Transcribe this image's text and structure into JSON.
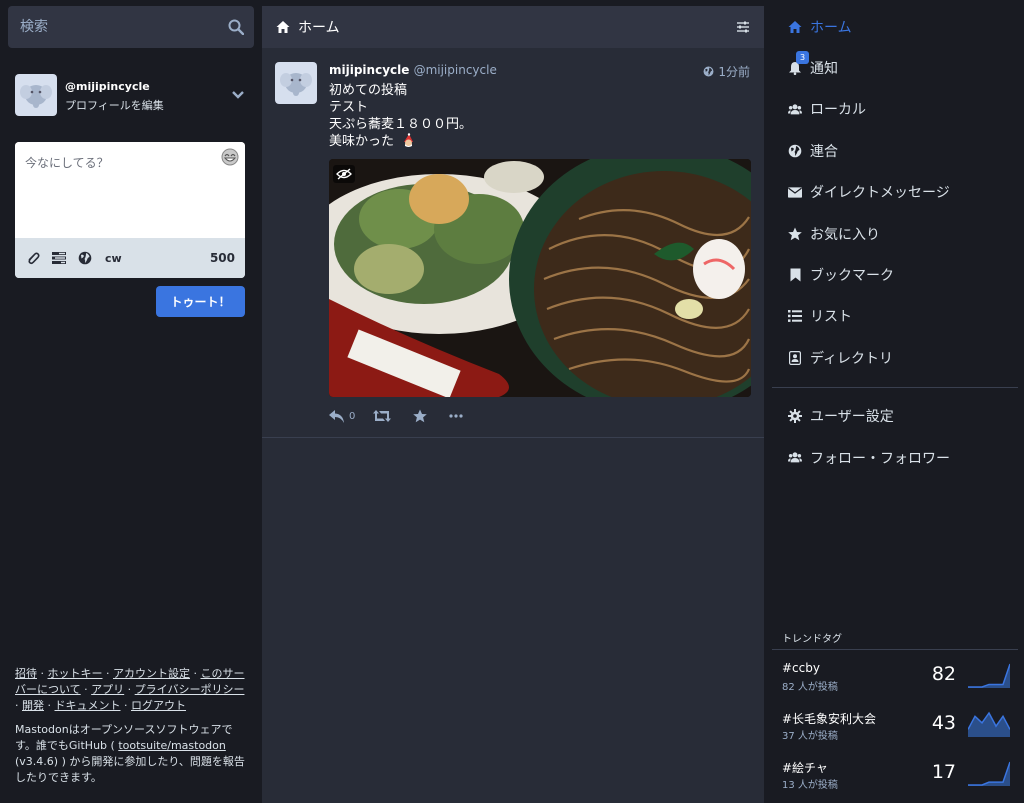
{
  "search": {
    "placeholder": "検索"
  },
  "account": {
    "handle": "@mijipincycle",
    "edit_label": "プロフィールを編集"
  },
  "compose": {
    "placeholder": "今なにしてる？",
    "cw_label": "cw",
    "char_count": "500",
    "submit_label": "トゥート！"
  },
  "footer": {
    "links": [
      {
        "label": "招待"
      },
      {
        "label": "ホットキー"
      },
      {
        "label": "アカウント設定"
      },
      {
        "label": "このサーバーについて"
      },
      {
        "label": "アプリ"
      },
      {
        "label": "プライバシーポリシー"
      },
      {
        "label": "開発"
      },
      {
        "label": "ドキュメント"
      },
      {
        "label": "ログアウト"
      }
    ],
    "separator": " · ",
    "about_prefix": "Mastodonはオープンソースソフトウェアです。誰でもGitHub ( ",
    "about_link": "tootsuite/mastodon",
    "about_suffix": " (v3.4.6) ) から開発に参加したり、問題を報告したりできます。"
  },
  "column": {
    "title": "ホーム"
  },
  "status": {
    "display_name": "mijipincycle",
    "acct": "@mijipincycle",
    "time": "1分前",
    "lines": [
      "初めての投稿",
      "テスト",
      "天ぷら蕎麦１８００円。",
      "美味かった"
    ],
    "reply_count": "0"
  },
  "nav": {
    "items": [
      {
        "label": "ホーム",
        "icon": "home-icon",
        "active": true
      },
      {
        "label": "通知",
        "icon": "bell-icon",
        "badge": "3"
      },
      {
        "label": "ローカル",
        "icon": "users-icon"
      },
      {
        "label": "連合",
        "icon": "globe-icon"
      },
      {
        "label": "ダイレクトメッセージ",
        "icon": "envelope-icon"
      },
      {
        "label": "お気に入り",
        "icon": "star-icon"
      },
      {
        "label": "ブックマーク",
        "icon": "bookmark-icon"
      },
      {
        "label": "リスト",
        "icon": "list-icon"
      },
      {
        "label": "ディレクトリ",
        "icon": "address-book-icon"
      }
    ],
    "secondary": [
      {
        "label": "ユーザー設定",
        "icon": "gear-icon"
      },
      {
        "label": "フォロー・フォロワー",
        "icon": "users-icon"
      }
    ]
  },
  "trends": {
    "title": "トレンドタグ",
    "items": [
      {
        "tag": "#ccby",
        "count_label": "82 人が投稿",
        "uses": "82",
        "history": [
          0,
          0,
          0,
          1,
          1,
          1,
          9
        ]
      },
      {
        "tag": "#长毛象安利大会",
        "count_label": "37 人が投稿",
        "uses": "43",
        "history": [
          2,
          6,
          4,
          7,
          3,
          6,
          2
        ]
      },
      {
        "tag": "#絵チャ",
        "count_label": "13 人が投稿",
        "uses": "17",
        "history": [
          0,
          0,
          0,
          1,
          1,
          1,
          8
        ]
      }
    ]
  },
  "colors": {
    "accent": "#3a75e0",
    "bg": "#191b22",
    "column": "#282c37",
    "muted": "#9baec8"
  }
}
